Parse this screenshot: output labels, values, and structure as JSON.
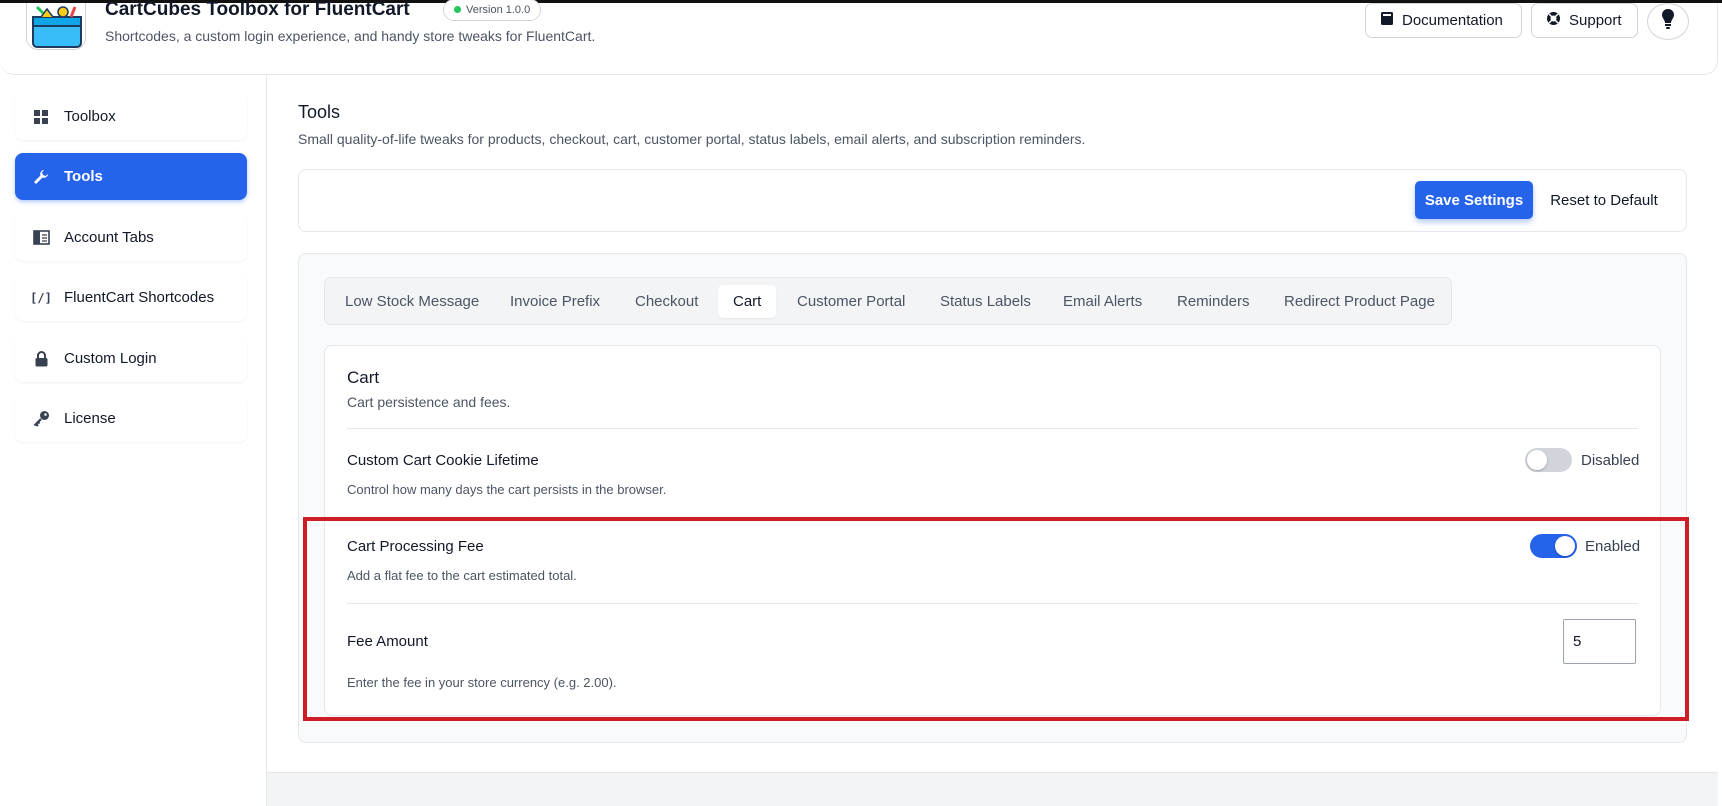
{
  "header": {
    "app_title": "CartCubes Toolbox for FluentCart",
    "version": "Version 1.0.0",
    "subtitle": "Shortcodes, a custom login experience, and handy store tweaks for FluentCart.",
    "documentation_label": "Documentation",
    "support_label": "Support"
  },
  "sidebar": {
    "items": [
      {
        "label": "Toolbox",
        "icon": "grid-icon"
      },
      {
        "label": "Tools",
        "icon": "wrench-icon",
        "active": true
      },
      {
        "label": "Account Tabs",
        "icon": "tabs-icon"
      },
      {
        "label": "FluentCart Shortcodes",
        "icon": "shortcode-icon"
      },
      {
        "label": "Custom Login",
        "icon": "lock-icon"
      },
      {
        "label": "License",
        "icon": "key-icon"
      }
    ]
  },
  "page": {
    "title": "Tools",
    "description": "Small quality-of-life tweaks for products, checkout, cart, customer portal, status labels, email alerts, and subscription reminders.",
    "save_label": "Save Settings",
    "reset_label": "Reset to Default"
  },
  "tabs": [
    {
      "label": "Low Stock Message"
    },
    {
      "label": "Invoice Prefix"
    },
    {
      "label": "Checkout"
    },
    {
      "label": "Cart",
      "active": true
    },
    {
      "label": "Customer Portal"
    },
    {
      "label": "Status Labels"
    },
    {
      "label": "Email Alerts"
    },
    {
      "label": "Reminders"
    },
    {
      "label": "Redirect Product Page"
    }
  ],
  "section": {
    "title": "Cart",
    "description": "Cart persistence and fees.",
    "fields": {
      "cookie_lifetime": {
        "label": "Custom Cart Cookie Lifetime",
        "help": "Control how many days the cart persists in the browser.",
        "state": "Disabled"
      },
      "processing_fee": {
        "label": "Cart Processing Fee",
        "help": "Add a flat fee to the cart estimated total.",
        "state": "Enabled"
      },
      "fee_amount": {
        "label": "Fee Amount",
        "value": "5",
        "help": "Enter the fee in your store currency (e.g. 2.00)."
      }
    }
  },
  "colors": {
    "accent": "#2563eb",
    "highlight": "#d01d25"
  }
}
